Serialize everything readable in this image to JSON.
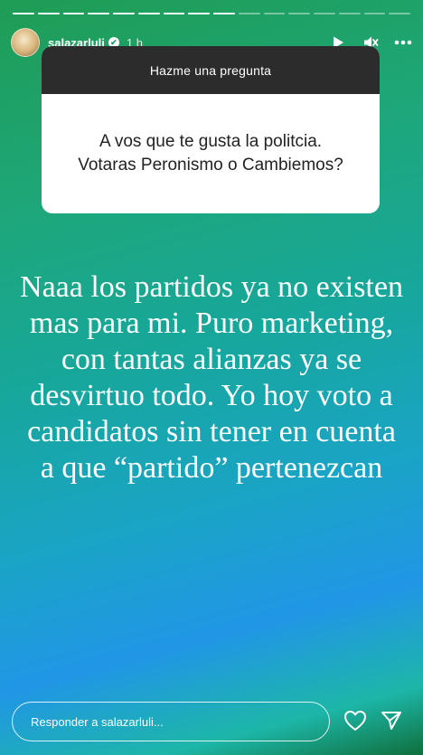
{
  "story": {
    "segments_total": 16,
    "segments_viewed": 9
  },
  "header": {
    "username": "salazarluli",
    "time": "1 h",
    "verified_icon": "✔"
  },
  "question_card": {
    "title": "Hazme una pregunta",
    "question": "A vos que te gusta la politcia. Votaras Peronismo o Cambiemos?"
  },
  "answer_text": "Naaa los partidos ya no existen mas para mi. Puro marketing, con tantas alianzas ya se desvirtuo todo. Yo hoy voto a candidatos sin tener en cuenta a que “partido” pertenezcan",
  "reply": {
    "placeholder": "Responder a salazarluli..."
  },
  "icons": [
    "play-icon",
    "mute-icon",
    "more-icon",
    "heart-icon",
    "send-icon"
  ],
  "colors": {
    "card_header": "#2c2c2c",
    "card_body": "#ffffff",
    "text": "#ffffff"
  }
}
